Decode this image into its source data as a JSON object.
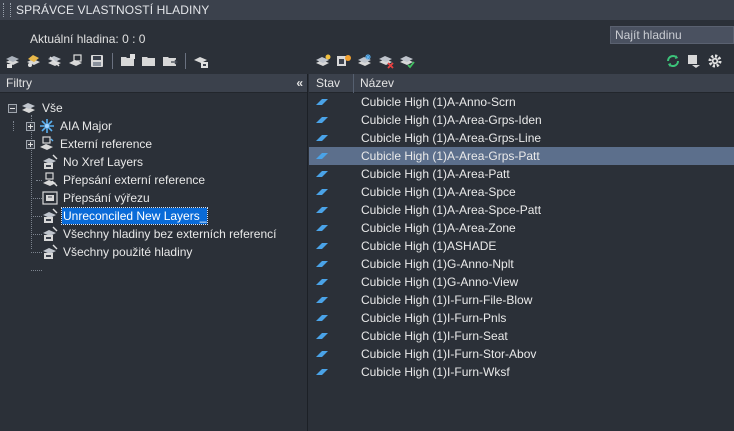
{
  "window": {
    "title": "SPRÁVCE VLASTNOSTÍ HLADINY"
  },
  "current_layer": {
    "label": "Aktuální hladina: 0 : 0"
  },
  "search": {
    "placeholder": "Najít hladinu"
  },
  "filters_panel": {
    "header": "Filtry",
    "root": "Vše",
    "items": [
      {
        "label": "AIA Major",
        "icon": "group-filter-icon",
        "expandable": true
      },
      {
        "label": "Externí reference",
        "icon": "xref-filter-icon",
        "expandable": true
      },
      {
        "label": "No Xref Layers",
        "icon": "property-filter-icon",
        "expandable": false
      },
      {
        "label": "Přepsání externí reference",
        "icon": "xref-override-icon",
        "expandable": false
      },
      {
        "label": "Přepsání výřezu",
        "icon": "viewport-override-icon",
        "expandable": false
      },
      {
        "label": "Unreconciled New Layers_",
        "icon": "property-filter-icon",
        "expandable": false,
        "selected": true
      },
      {
        "label": "Všechny hladiny bez externích referencí",
        "icon": "property-filter-icon",
        "expandable": false
      },
      {
        "label": "Všechny použité hladiny",
        "icon": "property-filter-icon",
        "expandable": false
      }
    ]
  },
  "layers_table": {
    "columns": [
      "Stav",
      "Název"
    ],
    "rows": [
      {
        "name": "Cubicle High (1)A-Anno-Scrn"
      },
      {
        "name": "Cubicle High (1)A-Area-Grps-Iden"
      },
      {
        "name": "Cubicle High (1)A-Area-Grps-Line"
      },
      {
        "name": "Cubicle High (1)A-Area-Grps-Patt",
        "selected": true
      },
      {
        "name": "Cubicle High (1)A-Area-Patt"
      },
      {
        "name": "Cubicle High (1)A-Area-Spce"
      },
      {
        "name": "Cubicle High (1)A-Area-Spce-Patt"
      },
      {
        "name": "Cubicle High (1)A-Area-Zone"
      },
      {
        "name": "Cubicle High (1)ASHADE"
      },
      {
        "name": "Cubicle High (1)G-Anno-Nplt"
      },
      {
        "name": "Cubicle High (1)G-Anno-View"
      },
      {
        "name": "Cubicle High (1)I-Furn-File-Blow"
      },
      {
        "name": "Cubicle High (1)I-Furn-Pnls"
      },
      {
        "name": "Cubicle High (1)I-Furn-Seat"
      },
      {
        "name": "Cubicle High (1)I-Furn-Stor-Abov"
      },
      {
        "name": "Cubicle High (1)I-Furn-Wksf"
      }
    ]
  },
  "colors": {
    "background": "#2b3038",
    "header": "#3b414c",
    "selected_filter": "#0a6bd8",
    "selected_row": "#5c6f8c",
    "layer_status_icon": "#4aa3e8",
    "refresh_icon": "#3cc47a"
  }
}
